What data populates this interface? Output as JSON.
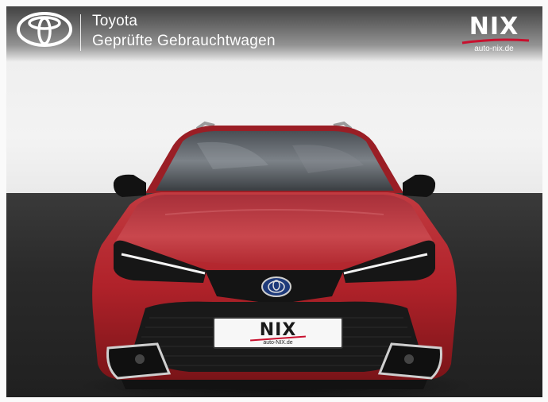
{
  "header": {
    "brand_title": "Toyota",
    "brand_subtitle": "Geprüfte Gebrauchtwagen",
    "logo_icon": "toyota-emblem-icon"
  },
  "dealer_logo": {
    "word": "NIX",
    "url": "auto-nix.de",
    "accent_color": "#c8102e"
  },
  "license_plate": {
    "word": "NIX",
    "url": "auto-NIX.de"
  },
  "colors": {
    "car_body": "#b8242c",
    "wall": "#f1f1f1",
    "floor": "#262626"
  }
}
